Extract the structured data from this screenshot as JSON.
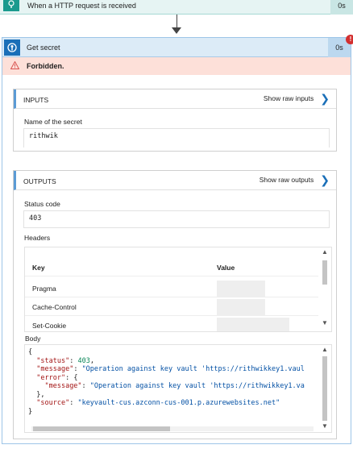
{
  "trigger": {
    "title": "When a HTTP request is received",
    "duration": "0s"
  },
  "action": {
    "title": "Get secret",
    "duration": "0s",
    "badge": "!",
    "error": "Forbidden."
  },
  "inputs": {
    "title": "INPUTS",
    "raw_label": "Show raw inputs",
    "fields": [
      {
        "label": "Name of the secret",
        "value": "rithwik"
      }
    ]
  },
  "outputs": {
    "title": "OUTPUTS",
    "raw_label": "Show raw outputs",
    "status_code_label": "Status code",
    "status_code": "403",
    "headers_label": "Headers",
    "headers_columns": {
      "key": "Key",
      "value": "Value"
    },
    "headers": [
      {
        "key": "Pragma"
      },
      {
        "key": "Cache-Control"
      },
      {
        "key": "Set-Cookie"
      }
    ],
    "body_label": "Body",
    "body": {
      "open": "{",
      "l1_key": "\"status\"",
      "l1_val": "403",
      "l2_key": "\"message\"",
      "l2_val": "\"Operation against key vault 'https://rithwikkey1.vaul",
      "l3_key": "\"error\"",
      "l3_open": "{",
      "l4_key": "\"message\"",
      "l4_val": "\"Operation against key vault 'https://rithwikkey1.va",
      "l5_close": "},",
      "l6_key": "\"source\"",
      "l6_val": "\"keyvault-cus.azconn-cus-001.p.azurewebsites.net\"",
      "close": "}"
    }
  },
  "colors": {
    "trigger_accent": "#1a9a8e",
    "action_accent": "#1a6fb8",
    "error_bg": "#fde0d9",
    "panel_accent": "#5b9bd5"
  }
}
